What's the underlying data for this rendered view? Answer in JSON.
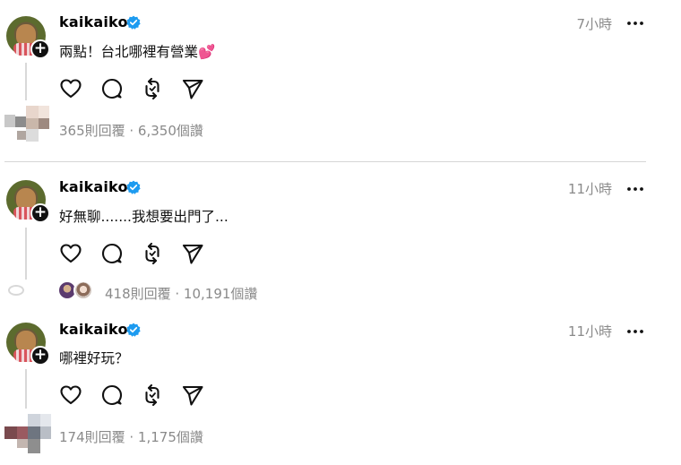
{
  "posts": [
    {
      "username": "kaikaiko",
      "time": "7小時",
      "text": "兩點！台北哪裡有營業",
      "emoji": "💕",
      "stats": "365則回覆 · 6,350個讚"
    },
    {
      "username": "kaikaiko",
      "time": "11小時",
      "text": "好無聊.......我想要出門了...",
      "stats": "418則回覆 · 10,191個讚"
    },
    {
      "username": "kaikaiko",
      "time": "11小時",
      "text": "哪裡好玩？",
      "stats": "174則回覆 · 1,175個讚"
    }
  ],
  "icons": {
    "like": "heart-icon",
    "reply": "comment-icon",
    "repost": "repost-icon",
    "share": "send-icon",
    "verified": "verified-badge-icon",
    "more": "more-dots-icon",
    "follow": "plus-icon"
  },
  "colors": {
    "verified": "#1d9bf0",
    "muted_text": "#8a8a8a",
    "divider": "#d6d6d6"
  }
}
